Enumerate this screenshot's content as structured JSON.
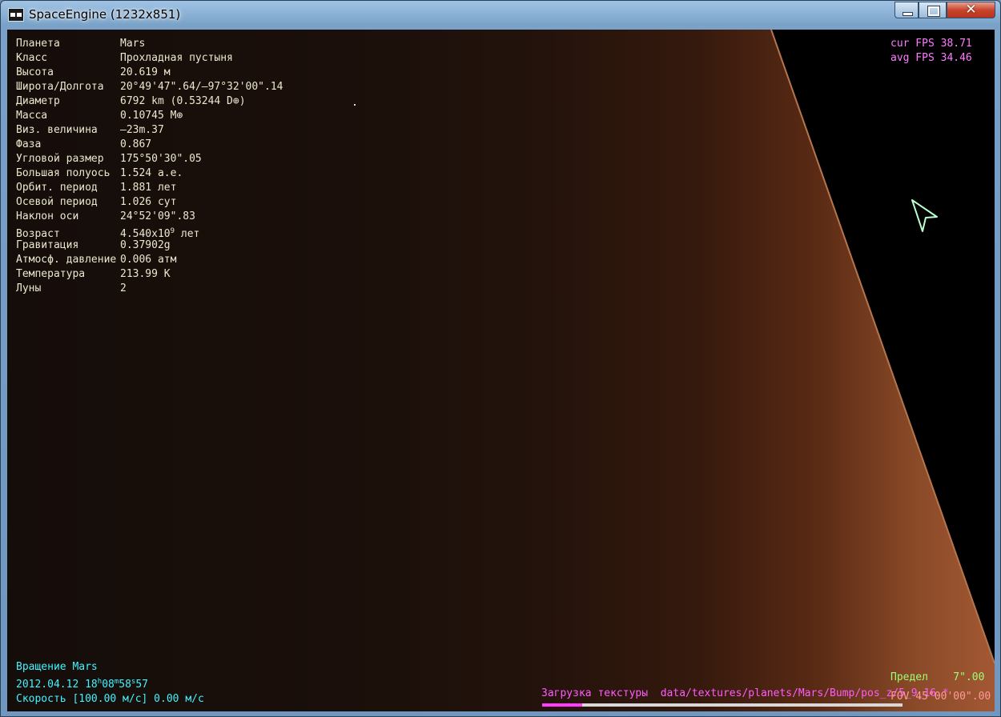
{
  "window": {
    "title": "SpaceEngine (1232x851)",
    "close_glyph": "✕"
  },
  "info": [
    {
      "label": "Планета",
      "value": "Mars"
    },
    {
      "label": "Класс",
      "value": "Прохладная пустыня"
    },
    {
      "label": "Высота",
      "value": "20.619 м"
    },
    {
      "label": "Широта/Долгота",
      "value": "20°49'47\".64/–97°32'00\".14"
    },
    {
      "label": "Диаметр",
      "value": "6792 km (0.53244 D⊕)"
    },
    {
      "label": "Масса",
      "value": "0.10745 M⊕"
    },
    {
      "label": "Виз. величина",
      "value": "–23m.37"
    },
    {
      "label": "Фаза",
      "value": "0.867"
    },
    {
      "label": "Угловой размер",
      "value": "175°50'30\".05"
    },
    {
      "label": "Большая полуось",
      "value": "1.524 а.е."
    },
    {
      "label": "Орбит. период",
      "value": "1.881 лет"
    },
    {
      "label": "Осевой период",
      "value": "1.026 сут"
    },
    {
      "label": "Наклон оси",
      "value": "24°52'09\".83"
    },
    {
      "label": "Возраст",
      "value_base": "4.540x10",
      "value_exp": "9",
      "value_unit": " лет"
    },
    {
      "label": "Гравитация",
      "value": "0.37902g"
    },
    {
      "label": "Атмосф. давление",
      "value": "0.006 атм"
    },
    {
      "label": "Температура",
      "value": "213.99 K"
    },
    {
      "label": "Луны",
      "value": "2"
    }
  ],
  "fps": {
    "cur": "cur FPS 38.71",
    "avg": "avg FPS 34.46"
  },
  "status": {
    "mode": "Вращение Mars",
    "date": "2012.04.12",
    "time_h": "18",
    "time_m": "08",
    "time_s": "58",
    "time_frac": "57",
    "speed": "Скорость [100.00 м/с] 0.00 м/с"
  },
  "limit": {
    "label": "Предел",
    "value": "7\".00"
  },
  "fov": "FOV 45°00'00\".00",
  "loading": {
    "label": "Загрузка текстуры",
    "path": "data/textures/planets/Mars/Bump/pos_z/5_9_16.*",
    "progress": 0.11
  },
  "colors": {
    "info": "#e9e9cf",
    "fps": "#ff7cff",
    "status": "#3ff3ff",
    "limit": "#9cff70",
    "loading": "#ff5cff"
  },
  "icons": [
    "app-icon",
    "minimize-icon",
    "maximize-icon",
    "close-icon",
    "mouse-pointer-icon"
  ]
}
